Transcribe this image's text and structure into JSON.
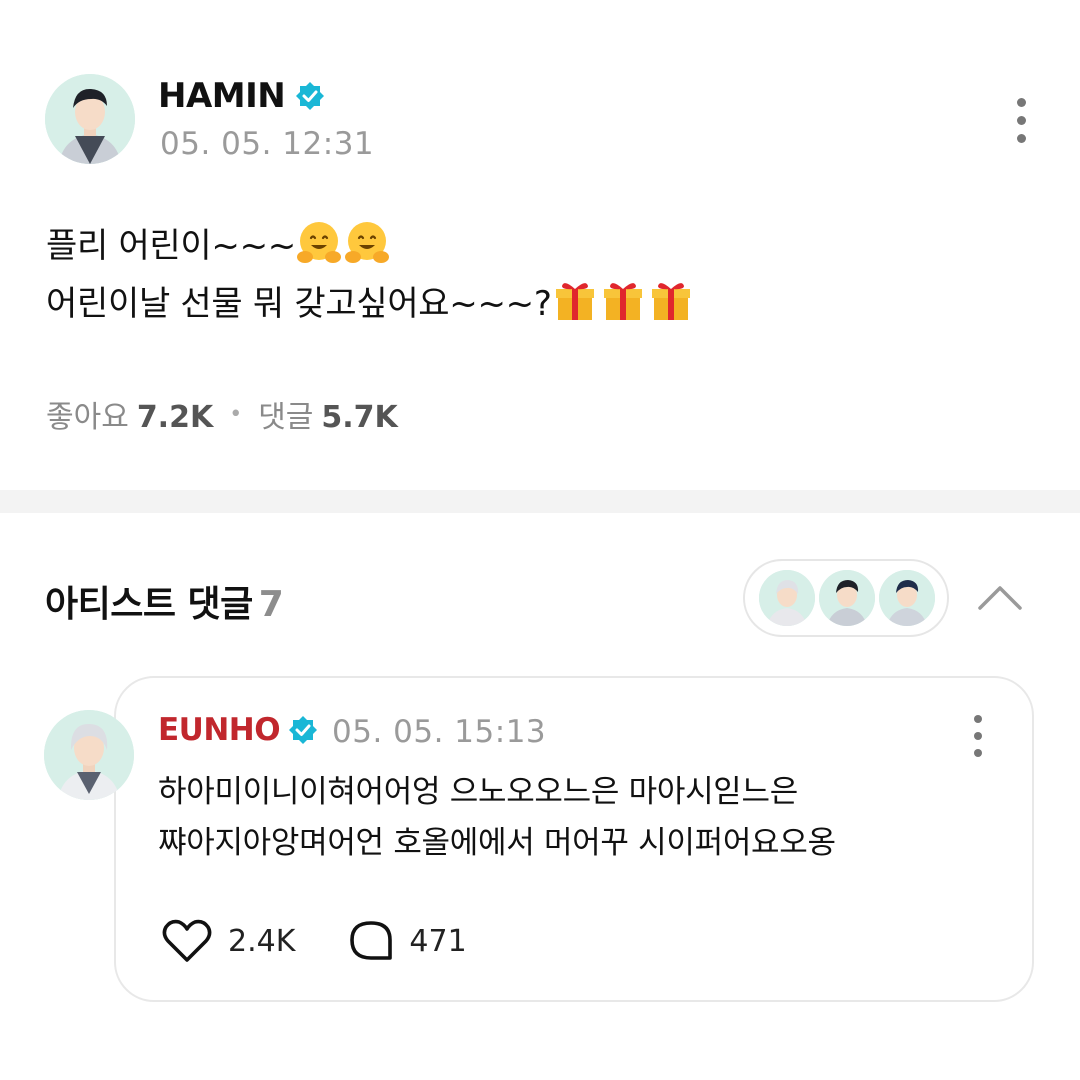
{
  "post": {
    "author": "HAMIN",
    "timestamp": "05. 05. 12:31",
    "line1": "플리 어린이~~~",
    "line2": "어린이날 선물 뭐 갖고싶어요~~~?",
    "line1_emoji": "hugging-face-emoji",
    "line2_emoji": "gift-emoji",
    "likes_label": "좋아요",
    "likes_count": "7.2K",
    "comments_label": "댓글",
    "comments_count": "5.7K"
  },
  "artist_comments": {
    "title": "아티스트 댓글",
    "count": "7",
    "avatars": [
      "artist-avatar-silver-hair",
      "artist-avatar-dark-hair",
      "artist-avatar-navy-hair"
    ]
  },
  "comment": {
    "author": "EUNHO",
    "timestamp": "05. 05. 15:13",
    "line1": "하아미이니이혀어어엉 으노오오느은 마아시읻느은",
    "line2": "쨔아지아앙며어언 호올에에서 머어꾸 시이퍼어요오옹",
    "likes": "2.4K",
    "replies": "471"
  },
  "colors": {
    "accent_red": "#c1272d",
    "verified_blue": "#1ab7d6",
    "muted_text": "#9a9a9a",
    "avatar_bg": "#d7efe8"
  }
}
